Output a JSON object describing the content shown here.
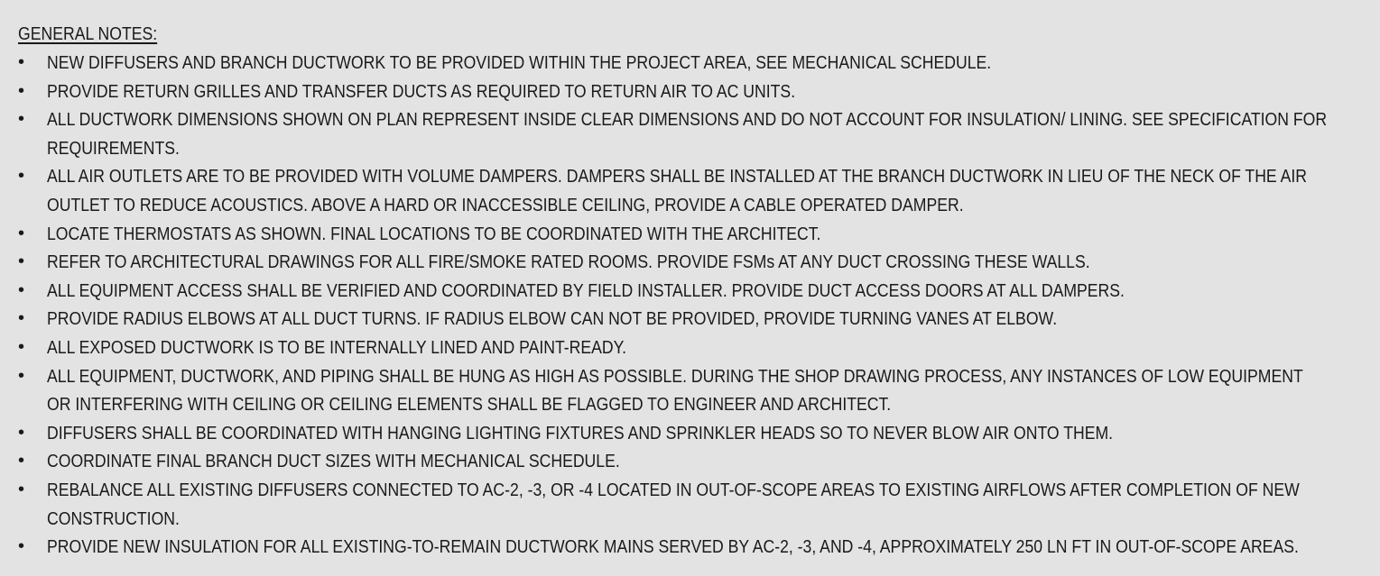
{
  "general_notes": {
    "heading": "GENERAL NOTES:",
    "bullet_glyph": "•",
    "notes": [
      {
        "lines": [
          "NEW DIFFUSERS AND BRANCH DUCTWORK TO BE PROVIDED WITHIN THE PROJECT AREA, SEE MECHANICAL SCHEDULE."
        ]
      },
      {
        "lines": [
          "PROVIDE RETURN GRILLES AND TRANSFER DUCTS AS REQUIRED TO RETURN AIR TO AC UNITS."
        ]
      },
      {
        "lines": [
          "ALL DUCTWORK DIMENSIONS SHOWN ON PLAN REPRESENT INSIDE CLEAR DIMENSIONS AND DO NOT ACCOUNT FOR INSULATION/ LINING. SEE SPECIFICATION FOR",
          "REQUIREMENTS."
        ]
      },
      {
        "lines": [
          "ALL AIR OUTLETS ARE TO BE PROVIDED WITH VOLUME DAMPERS. DAMPERS SHALL BE INSTALLED AT THE BRANCH DUCTWORK IN LIEU OF THE NECK OF THE AIR",
          "OUTLET TO REDUCE ACOUSTICS. ABOVE A HARD OR INACCESSIBLE CEILING, PROVIDE A CABLE OPERATED DAMPER."
        ]
      },
      {
        "lines": [
          "LOCATE THERMOSTATS AS SHOWN. FINAL LOCATIONS TO BE COORDINATED WITH THE ARCHITECT."
        ]
      },
      {
        "lines": [
          "REFER TO ARCHITECTURAL DRAWINGS FOR ALL FIRE/SMOKE RATED ROOMS. PROVIDE FSMs AT ANY DUCT CROSSING THESE WALLS."
        ]
      },
      {
        "lines": [
          "ALL EQUIPMENT ACCESS SHALL BE VERIFIED AND COORDINATED BY FIELD INSTALLER. PROVIDE DUCT ACCESS DOORS AT ALL DAMPERS."
        ]
      },
      {
        "lines": [
          "PROVIDE RADIUS ELBOWS AT ALL DUCT TURNS. IF RADIUS ELBOW CAN NOT BE PROVIDED, PROVIDE TURNING VANES AT ELBOW."
        ]
      },
      {
        "lines": [
          "ALL EXPOSED DUCTWORK IS TO BE INTERNALLY LINED AND PAINT-READY."
        ]
      },
      {
        "lines": [
          "ALL EQUIPMENT, DUCTWORK, AND PIPING SHALL BE HUNG AS HIGH AS POSSIBLE. DURING THE SHOP DRAWING PROCESS, ANY INSTANCES OF LOW EQUIPMENT",
          "OR INTERFERING WITH CEILING OR CEILING ELEMENTS SHALL BE FLAGGED TO ENGINEER AND ARCHITECT."
        ]
      },
      {
        "lines": [
          "DIFFUSERS SHALL BE COORDINATED WITH HANGING LIGHTING FIXTURES AND SPRINKLER HEADS SO TO NEVER BLOW AIR ONTO THEM."
        ]
      },
      {
        "lines": [
          "COORDINATE FINAL BRANCH DUCT SIZES WITH MECHANICAL SCHEDULE."
        ]
      },
      {
        "lines": [
          "REBALANCE ALL EXISTING DIFFUSERS CONNECTED TO AC-2, -3, OR -4 LOCATED IN OUT-OF-SCOPE AREAS TO EXISTING AIRFLOWS AFTER COMPLETION OF NEW",
          "CONSTRUCTION."
        ]
      },
      {
        "lines": [
          "PROVIDE NEW INSULATION FOR ALL EXISTING-TO-REMAIN  DUCTWORK MAINS SERVED BY AC-2, -3, AND -4, APPROXIMATELY 250 LN FT IN OUT-OF-SCOPE AREAS."
        ]
      }
    ]
  }
}
